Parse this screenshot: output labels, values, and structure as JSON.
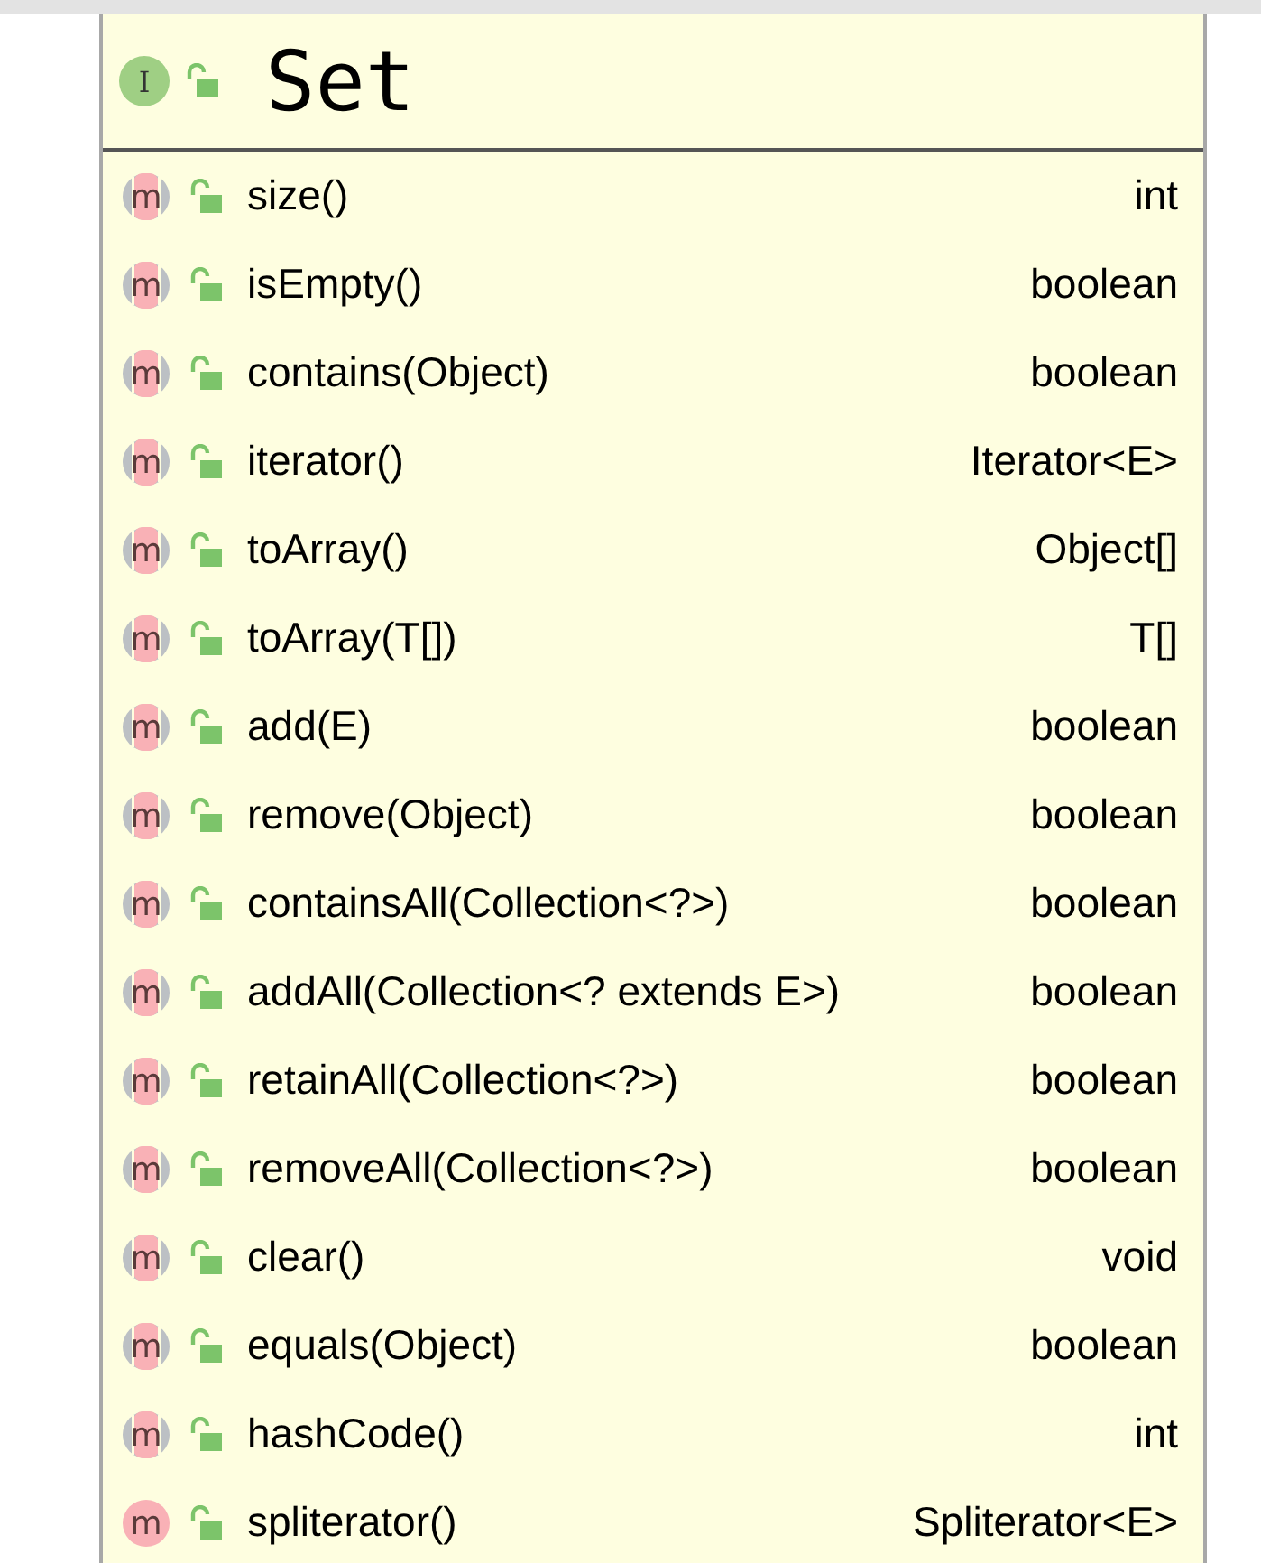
{
  "class_box": {
    "title": "Set",
    "icon_letter": "I"
  },
  "methods": [
    {
      "name": "size()",
      "type": "int",
      "kind": "inherited",
      "icon_letter": "m"
    },
    {
      "name": "isEmpty()",
      "type": "boolean",
      "kind": "inherited",
      "icon_letter": "m"
    },
    {
      "name": "contains(Object)",
      "type": "boolean",
      "kind": "inherited",
      "icon_letter": "m"
    },
    {
      "name": "iterator()",
      "type": "Iterator<E>",
      "kind": "inherited",
      "icon_letter": "m"
    },
    {
      "name": "toArray()",
      "type": "Object[]",
      "kind": "inherited",
      "icon_letter": "m"
    },
    {
      "name": "toArray(T[])",
      "type": "T[]",
      "kind": "inherited",
      "icon_letter": "m"
    },
    {
      "name": "add(E)",
      "type": "boolean",
      "kind": "inherited",
      "icon_letter": "m"
    },
    {
      "name": "remove(Object)",
      "type": "boolean",
      "kind": "inherited",
      "icon_letter": "m"
    },
    {
      "name": "containsAll(Collection<?>)",
      "type": "boolean",
      "kind": "inherited",
      "icon_letter": "m"
    },
    {
      "name": "addAll(Collection<? extends E>)",
      "type": "boolean",
      "kind": "inherited",
      "icon_letter": "m"
    },
    {
      "name": "retainAll(Collection<?>)",
      "type": "boolean",
      "kind": "inherited",
      "icon_letter": "m"
    },
    {
      "name": "removeAll(Collection<?>)",
      "type": "boolean",
      "kind": "inherited",
      "icon_letter": "m"
    },
    {
      "name": "clear()",
      "type": "void",
      "kind": "inherited",
      "icon_letter": "m"
    },
    {
      "name": "equals(Object)",
      "type": "boolean",
      "kind": "inherited",
      "icon_letter": "m"
    },
    {
      "name": "hashCode()",
      "type": "int",
      "kind": "inherited",
      "icon_letter": "m"
    },
    {
      "name": "spliterator()",
      "type": "Spliterator<E>",
      "kind": "default",
      "icon_letter": "m"
    }
  ]
}
